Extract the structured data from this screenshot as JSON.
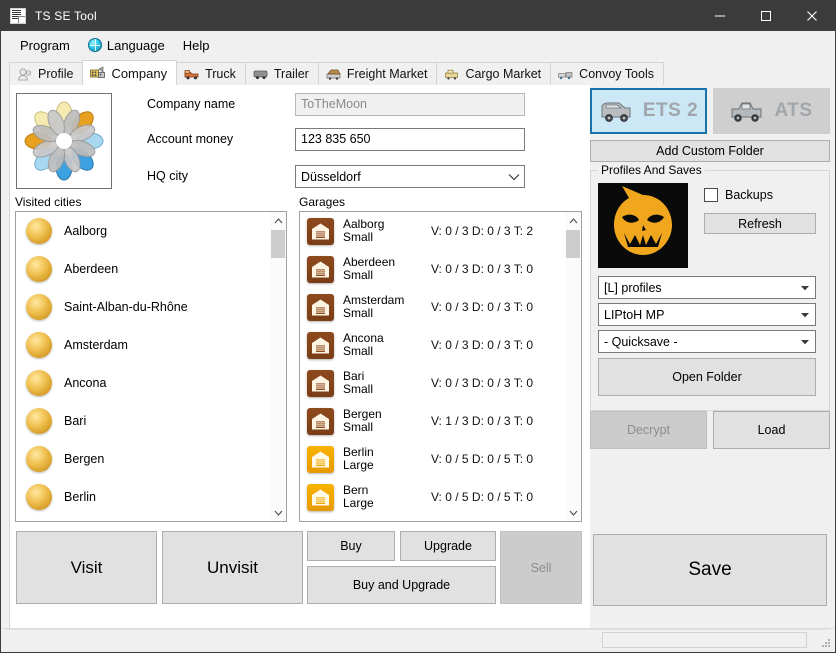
{
  "window": {
    "title": "TS SE Tool",
    "icon": "document-grid-icon",
    "minimize_label": "—",
    "maximize_label": "□",
    "close_label": "✕"
  },
  "menubar": {
    "items": [
      {
        "label": "Program",
        "icon": null
      },
      {
        "label": "Language",
        "icon": "globe-icon"
      },
      {
        "label": "Help",
        "icon": null
      }
    ]
  },
  "tabs": [
    {
      "label": "Profile",
      "icon": "profile-icon",
      "active": false
    },
    {
      "label": "Company",
      "icon": "company-icon",
      "active": true
    },
    {
      "label": "Truck",
      "icon": "truck-icon",
      "active": false
    },
    {
      "label": "Trailer",
      "icon": "trailer-icon",
      "active": false
    },
    {
      "label": "Freight Market",
      "icon": "freight-market-icon",
      "active": false
    },
    {
      "label": "Cargo Market",
      "icon": "cargo-market-icon",
      "active": false
    },
    {
      "label": "Convoy Tools",
      "icon": "convoy-tools-icon",
      "active": false
    }
  ],
  "company": {
    "logo_icon": "company-logo-flower",
    "fields": [
      {
        "label": "Company name",
        "value": "ToTheMoon",
        "readonly": true
      },
      {
        "label": "Account money",
        "value": "123 835 650",
        "readonly": false
      }
    ],
    "hq_city": {
      "label": "HQ city",
      "value": "Düsseldorf"
    }
  },
  "visited_cities": {
    "title": "Visited cities",
    "items": [
      {
        "name": "Aalborg"
      },
      {
        "name": "Aberdeen"
      },
      {
        "name": "Saint-Alban-du-Rhône"
      },
      {
        "name": "Amsterdam"
      },
      {
        "name": "Ancona"
      },
      {
        "name": "Bari"
      },
      {
        "name": "Bergen"
      },
      {
        "name": "Berlin"
      }
    ]
  },
  "garages": {
    "title": "Garages",
    "items": [
      {
        "city": "Aalborg",
        "size": "Small",
        "stats": "V: 0 / 3 D: 0 / 3 T: 2"
      },
      {
        "city": "Aberdeen",
        "size": "Small",
        "stats": "V: 0 / 3 D: 0 / 3 T: 0"
      },
      {
        "city": "Amsterdam",
        "size": "Small",
        "stats": "V: 0 / 3 D: 0 / 3 T: 0"
      },
      {
        "city": "Ancona",
        "size": "Small",
        "stats": "V: 0 / 3 D: 0 / 3 T: 0"
      },
      {
        "city": "Bari",
        "size": "Small",
        "stats": "V: 0 / 3 D: 0 / 3 T: 0"
      },
      {
        "city": "Bergen",
        "size": "Small",
        "stats": "V: 1 / 3 D: 0 / 3 T: 0"
      },
      {
        "city": "Berlin",
        "size": "Large",
        "stats": "V: 0 / 5 D: 0 / 5 T: 0"
      },
      {
        "city": "Bern",
        "size": "Large",
        "stats": "V: 0 / 5 D: 0 / 5 T: 0"
      }
    ]
  },
  "actions": {
    "visit": "Visit",
    "unvisit": "Unvisit",
    "buy": "Buy",
    "upgrade": "Upgrade",
    "buy_and_upgrade": "Buy and Upgrade",
    "sell": "Sell"
  },
  "sidebar": {
    "game_buttons": [
      {
        "label": "ETS 2",
        "icon": "ets2-truck-icon",
        "selected": true
      },
      {
        "label": "ATS",
        "icon": "ats-truck-icon",
        "selected": false
      }
    ],
    "add_custom_folder": "Add Custom Folder",
    "profiles_group_title": "Profiles And Saves",
    "avatar_icon": "soul-eater-avatar",
    "backups_label": "Backups",
    "backups_checked": false,
    "refresh": "Refresh",
    "profile_folder": "[L] profiles",
    "profile_name": "LIPtoH MP",
    "save_name": "- Quicksave -",
    "open_folder": "Open Folder",
    "decrypt": "Decrypt",
    "decrypt_disabled": true,
    "load": "Load",
    "save": "Save"
  },
  "statusbar": {
    "text": ""
  },
  "colors": {
    "titlebar": "#3c3c3c",
    "window_bg": "#f0f0f0",
    "accent_selected": "#cce8f7",
    "accent_border": "#1a73a8",
    "garage_small": "#8d4a1d",
    "garage_large": "#f9b300",
    "city_dot": "#f0c050"
  }
}
